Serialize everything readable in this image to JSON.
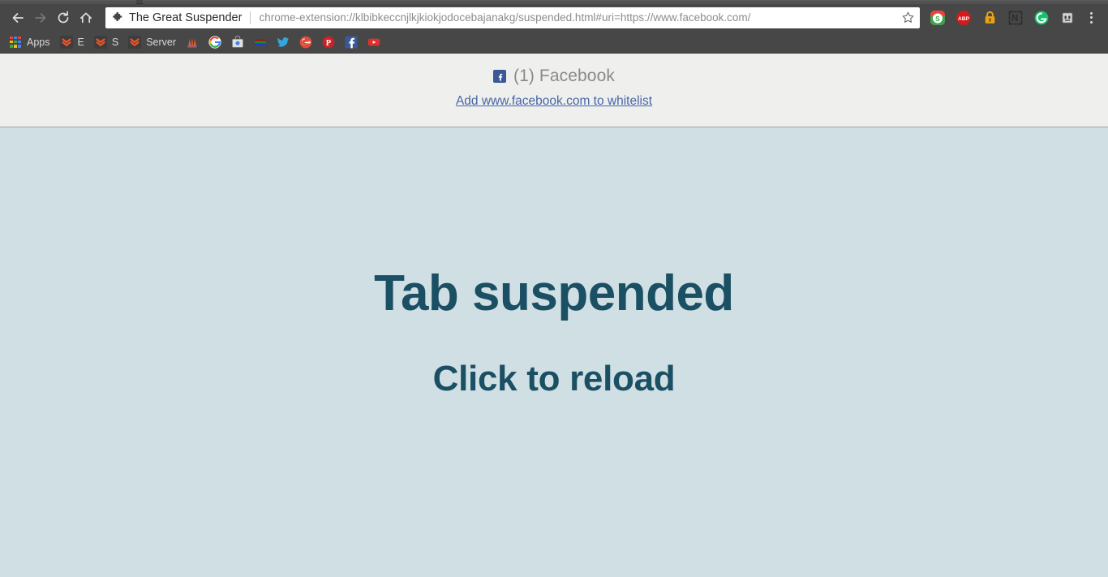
{
  "browser": {
    "nav": {
      "back_icon": "back-arrow-icon",
      "forward_icon": "forward-arrow-icon",
      "reload_icon": "reload-icon",
      "home_icon": "home-icon"
    },
    "omnibox": {
      "extension_icon": "puzzle-piece-icon",
      "extension_name": "The Great Suspender",
      "url": "chrome-extension://klbibkeccnjlkjkiokjodocebajanakg/suspended.html#uri=https://www.facebook.com/",
      "bookmark_icon": "star-outline-icon"
    },
    "extensions": [
      {
        "name": "stylish-extension-icon",
        "label": "S",
        "color": "#2bb24c"
      },
      {
        "name": "adblock-plus-icon",
        "label": "ABP",
        "color": "#d61a1a"
      },
      {
        "name": "padlock-extension-icon",
        "label": "",
        "color": "#e8a317"
      },
      {
        "name": "nimbus-screenshot-icon",
        "label": "N",
        "color": "#2c2c2c"
      },
      {
        "name": "grammarly-icon",
        "label": "G",
        "color": "#15c26b"
      },
      {
        "name": "robot-extension-icon",
        "label": "",
        "color": "#d4d4d4"
      }
    ],
    "menu_icon": "three-dot-menu-icon",
    "bookmarks": [
      {
        "name": "apps-shortcut",
        "icon": "apps-grid-icon",
        "label": "Apps"
      },
      {
        "name": "bookmark-e",
        "icon": "orange-chevron-icon",
        "label": "E"
      },
      {
        "name": "bookmark-s",
        "icon": "orange-chevron-icon",
        "label": "S"
      },
      {
        "name": "bookmark-server",
        "icon": "orange-chevron-icon",
        "label": "Server"
      },
      {
        "name": "bookmark-prabhu",
        "icon": "orange-temple-icon",
        "label": ""
      },
      {
        "name": "bookmark-google",
        "icon": "google-g-icon",
        "label": ""
      },
      {
        "name": "bookmark-webstore",
        "icon": "chrome-web-store-icon",
        "label": ""
      },
      {
        "name": "bookmark-stripes",
        "icon": "rgb-stripes-icon",
        "label": ""
      },
      {
        "name": "bookmark-twitter",
        "icon": "twitter-bird-icon",
        "label": ""
      },
      {
        "name": "bookmark-googleplus",
        "icon": "google-plus-icon",
        "label": ""
      },
      {
        "name": "bookmark-pinterest",
        "icon": "pinterest-p-icon",
        "label": ""
      },
      {
        "name": "bookmark-facebook",
        "icon": "facebook-f-icon",
        "label": ""
      },
      {
        "name": "bookmark-youtube",
        "icon": "youtube-play-icon",
        "label": ""
      }
    ]
  },
  "suspended_page": {
    "favicon": "facebook-favicon",
    "title": "(1) Facebook",
    "whitelist_link": "Add www.facebook.com to whitelist",
    "heading": "Tab suspended",
    "subheading": "Click to reload",
    "colors": {
      "background": "#cfdfe4",
      "header_background": "#efefed",
      "text": "#1b4f63",
      "link": "#4767a8",
      "facebook_blue": "#3b5998"
    }
  }
}
